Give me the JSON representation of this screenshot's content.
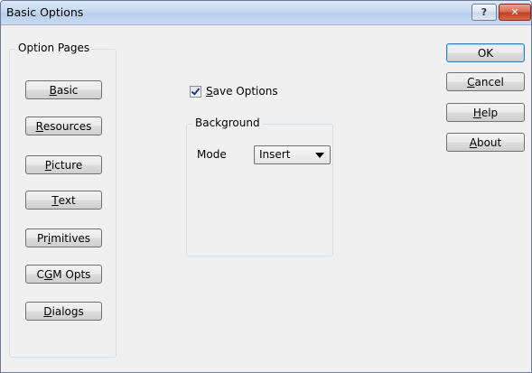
{
  "window": {
    "title": "Basic Options",
    "help_glyph": "?",
    "close_glyph": "✕"
  },
  "option_pages": {
    "label": "Option Pages",
    "buttons": [
      {
        "pre": "",
        "key": "B",
        "post": "asic"
      },
      {
        "pre": "",
        "key": "R",
        "post": "esources"
      },
      {
        "pre": "",
        "key": "P",
        "post": "icture"
      },
      {
        "pre": "",
        "key": "T",
        "post": "ext"
      },
      {
        "pre": "Pr",
        "key": "i",
        "post": "mitives"
      },
      {
        "pre": "C",
        "key": "G",
        "post": "M Opts"
      },
      {
        "pre": "",
        "key": "D",
        "post": "ialogs"
      }
    ]
  },
  "save_options": {
    "key": "S",
    "rest": "ave Options",
    "checked": true
  },
  "background": {
    "label": "Background",
    "mode_label": "Mode",
    "mode_value": "Insert"
  },
  "actions": {
    "ok": "OK",
    "cancel": {
      "key": "C",
      "rest": "ancel"
    },
    "help": {
      "key": "H",
      "rest": "elp"
    },
    "about": {
      "key": "A",
      "rest": "bout"
    }
  }
}
